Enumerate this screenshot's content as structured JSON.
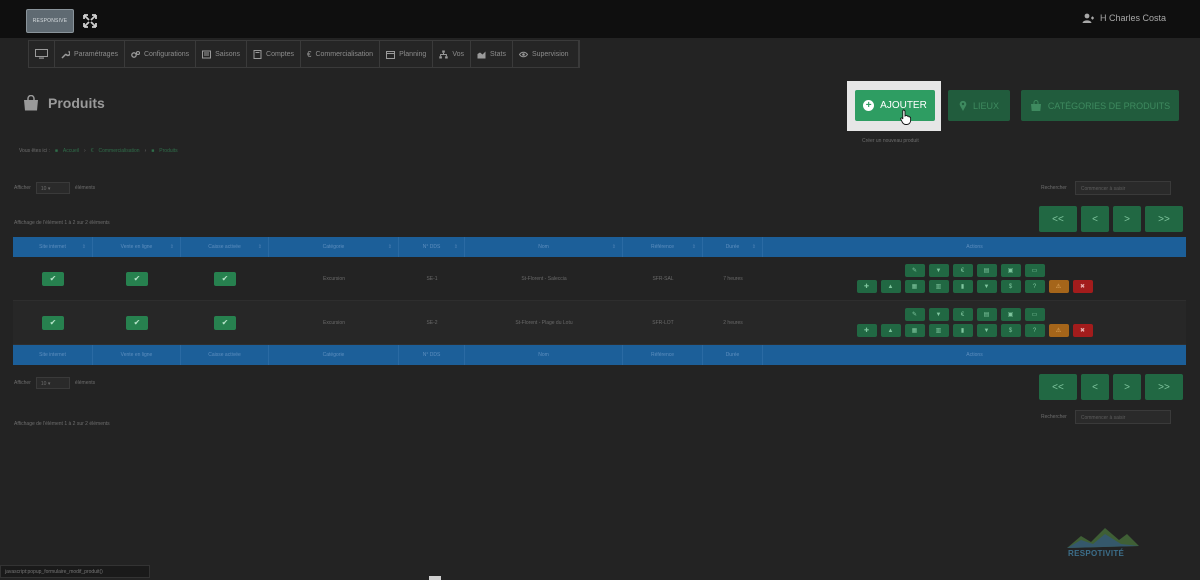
{
  "topbar": {
    "logo_text": "RESPONSIVE",
    "user_name": "H Charles Costa"
  },
  "nav": [
    {
      "label": ""
    },
    {
      "label": "Paramétrages"
    },
    {
      "label": "Configurations"
    },
    {
      "label": "Saisons"
    },
    {
      "label": "Comptes"
    },
    {
      "label": "Commercialisation"
    },
    {
      "label": "Planning"
    },
    {
      "label": "Vos"
    },
    {
      "label": "Stats"
    },
    {
      "label": "Supervision"
    }
  ],
  "page": {
    "title": "Produits"
  },
  "buttons": {
    "ajouter": "AJOUTER",
    "lieux": "LIEUX",
    "categories": "CATÉGORIES DE PRODUITS",
    "ajouter_tooltip": "Créer un nouveau produit"
  },
  "breadcrumb": {
    "prefix": "Vous êtes ici :",
    "items": [
      "Accueil",
      "Commercialisation",
      "Produits"
    ]
  },
  "list_controls": {
    "show_label": "Afficher",
    "per_page": "10",
    "elements_label": "éléments",
    "search_label": "Rechercher",
    "search_placeholder": "Commencer à saisir",
    "info_text": "Affichage de l'élément 1 à 2 sur 2 éléments"
  },
  "pager": [
    "<<",
    "<",
    ">",
    ">>"
  ],
  "table": {
    "columns": [
      "Site internet",
      "Vente en ligne",
      "Caisse activée",
      "Catégorie",
      "N° DDS",
      "Nom",
      "Référence",
      "Durée",
      "Actions"
    ],
    "rows": [
      {
        "categorie": "Excursion",
        "dds": "SE-1",
        "nom": "St-Florent - Saleccia",
        "reference": "SFR-SAL",
        "duree": "7 heures"
      },
      {
        "categorie": "Excursion",
        "dds": "SE-2",
        "nom": "St-Florent - Plage du Lotu",
        "reference": "SFR-LOT",
        "duree": "2 heures"
      }
    ]
  },
  "status_bar": "javascript:popup_formulaire_modif_produit()",
  "watermark": "RESPOTIVITÉ",
  "colors": {
    "primary_green": "#2e9d62",
    "dim_green": "#216843",
    "table_header_blue": "#1c5f99",
    "orange": "#a5651a",
    "red": "#a31c1c"
  }
}
